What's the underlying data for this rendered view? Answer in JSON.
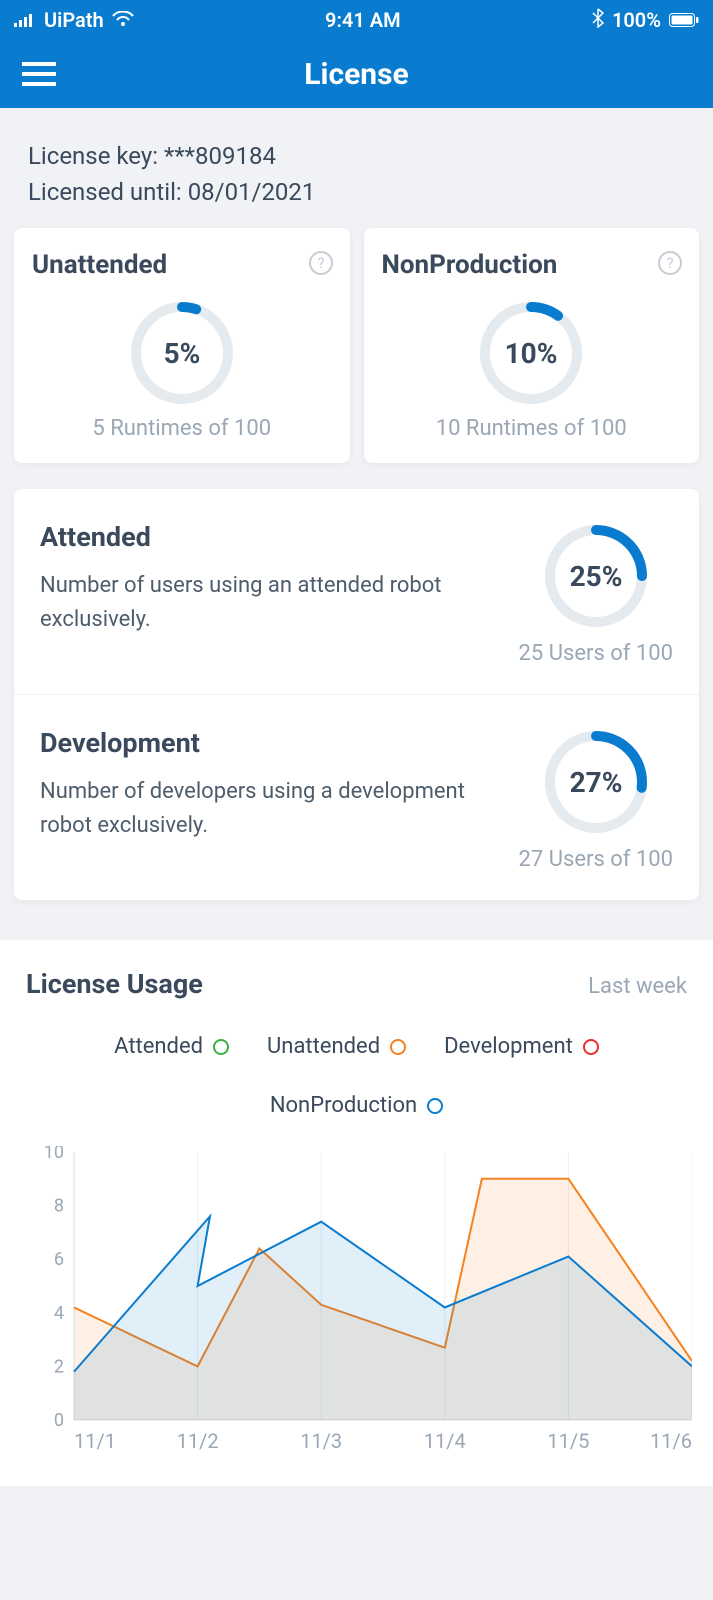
{
  "status_bar": {
    "carrier": "UiPath",
    "time": "9:41 AM",
    "battery": "100%"
  },
  "header": {
    "title": "License"
  },
  "license": {
    "key_label": "License key: ",
    "key_value": "***809184",
    "until_label": "Licensed until: ",
    "until_value": "08/01/2021"
  },
  "cards_small": [
    {
      "title": "Unattended",
      "percent": 5,
      "percent_label": "5%",
      "sub": "5 Runtimes of 100"
    },
    {
      "title": "NonProduction",
      "percent": 10,
      "percent_label": "10%",
      "sub": "10 Runtimes of 100"
    }
  ],
  "cards_list": [
    {
      "title": "Attended",
      "desc": "Number of users using an attended robot exclusively.",
      "percent": 25,
      "percent_label": "25%",
      "sub": "25 Users of 100"
    },
    {
      "title": "Development",
      "desc": "Number of developers using a development robot exclusively.",
      "percent": 27,
      "percent_label": "27%",
      "sub": "27 Users of 100"
    }
  ],
  "usage": {
    "title": "License Usage",
    "period": "Last week",
    "legend": [
      {
        "name": "Attended",
        "color": "#3cb043"
      },
      {
        "name": "Unattended",
        "color": "#f58220"
      },
      {
        "name": "Development",
        "color": "#e8312f"
      },
      {
        "name": "NonProduction",
        "color": "#0a7ccf"
      }
    ]
  },
  "chart_data": {
    "type": "area",
    "title": "License Usage",
    "xlabel": "",
    "ylabel": "",
    "ylim": [
      0,
      10
    ],
    "categories": [
      "11/1",
      "11/2",
      "11/3",
      "11/4",
      "11/5",
      "11/6"
    ],
    "series": [
      {
        "name": "Attended",
        "color": "#3cb043",
        "values": [
          null,
          null,
          null,
          null,
          null,
          null
        ]
      },
      {
        "name": "Unattended",
        "color": "#f58220",
        "values": [
          4.2,
          2.0,
          4.3,
          2.7,
          9.0,
          2.2
        ]
      },
      {
        "name": "Development",
        "color": "#e8312f",
        "values": [
          null,
          null,
          null,
          null,
          null,
          null
        ]
      },
      {
        "name": "NonProduction",
        "color": "#0a7ccf",
        "values": [
          1.8,
          5.0,
          7.4,
          4.2,
          6.1,
          2.0
        ]
      }
    ],
    "annotations": [
      "Attended and Development legend items present but no visible data series in view"
    ]
  },
  "colors": {
    "brand": "#0a7ccf",
    "track": "#e5eaef",
    "muted": "#9aa7b4"
  }
}
